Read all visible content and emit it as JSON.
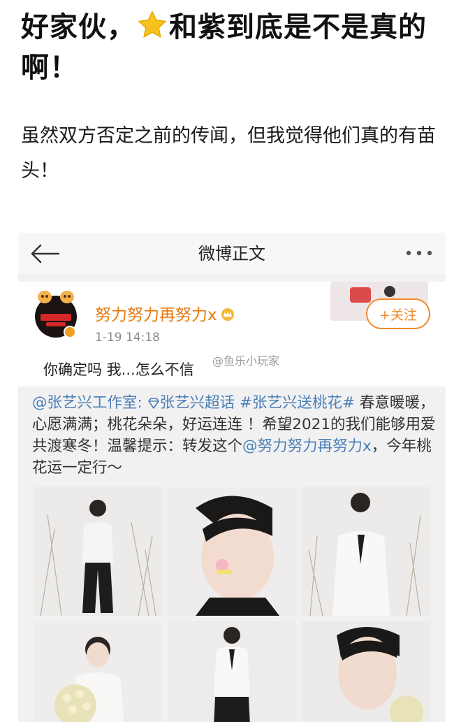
{
  "article": {
    "headline_part1": "好家伙，",
    "headline_part2": "和紫到底是不是真的啊！",
    "star_icon": "star-emoji-icon",
    "body": "虽然双方否定之前的传闻，但我觉得他们真的有苗头！"
  },
  "weibo": {
    "nav_title": "微博正文",
    "back_icon": "back-arrow-icon",
    "more_icon": "more-dots-icon",
    "username": "努力努力再努力x",
    "timestamp": "1-19 14:18",
    "follow_label": "+关注",
    "post_text": "你确定吗 我...怎么不信",
    "watermark": "@鱼乐小玩家",
    "repost": {
      "mention_studio": "@张艺兴工作室:",
      "topic1": "张艺兴超话",
      "topic2": "#张艺兴送桃花#",
      "text1": "春意暖暖，心愿满满；桃花朵朵，好运连连 ！希望2021的我们能够用爱共渡寒冬！温馨提示：转发这个",
      "mention_user": "@努力努力再努力x",
      "text2": "，今年桃花运一定行～"
    },
    "photos": [
      "photo-1",
      "photo-2",
      "photo-3",
      "photo-4",
      "photo-5",
      "photo-6"
    ]
  },
  "colors": {
    "accent": "#f08a2a",
    "link": "#4a7fb8",
    "username": "#e8770c"
  }
}
